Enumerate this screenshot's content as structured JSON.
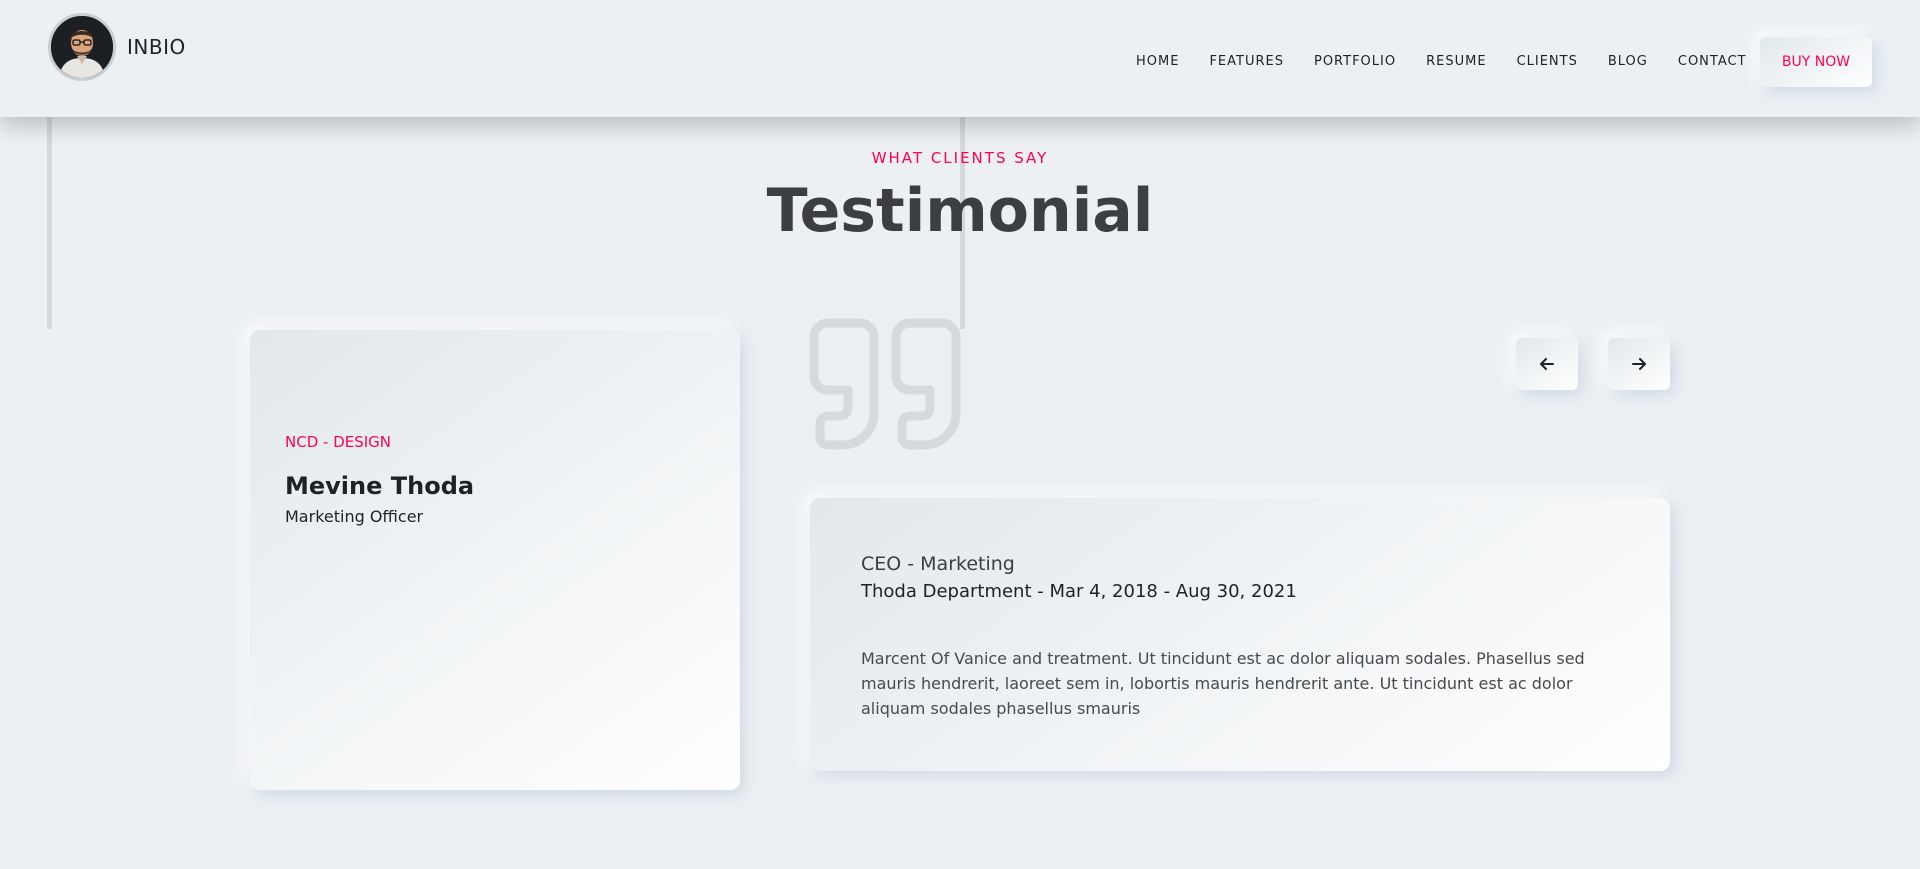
{
  "header": {
    "brand": "INBIO",
    "nav": [
      "HOME",
      "FEATURES",
      "PORTFOLIO",
      "RESUME",
      "CLIENTS",
      "BLOG",
      "CONTACT"
    ],
    "buy_label": "BUY NOW"
  },
  "section": {
    "subtitle": "WHAT CLIENTS SAY",
    "title": "Testimonial"
  },
  "client_card": {
    "tag": "NCD - DESIGN",
    "name": "Mevine Thoda",
    "role": "Marketing Officer"
  },
  "testimonial": {
    "role": "CEO - Marketing",
    "department": "Thoda Department - Mar 4, 2018 - Aug 30, 2021",
    "text": "Marcent Of Vanice and treatment. Ut tincidunt est ac dolor aliquam sodales. Phasellus sed mauris hendrerit, laoreet sem in, lobortis mauris hendrerit ante. Ut tincidunt est ac dolor aliquam sodales phasellus smauris"
  },
  "controls": {
    "prev_icon": "arrow-left-icon",
    "next_icon": "arrow-right-icon"
  },
  "colors": {
    "accent": "#ff014f",
    "background": "#ecf0f3",
    "heading": "#3c3e41"
  }
}
